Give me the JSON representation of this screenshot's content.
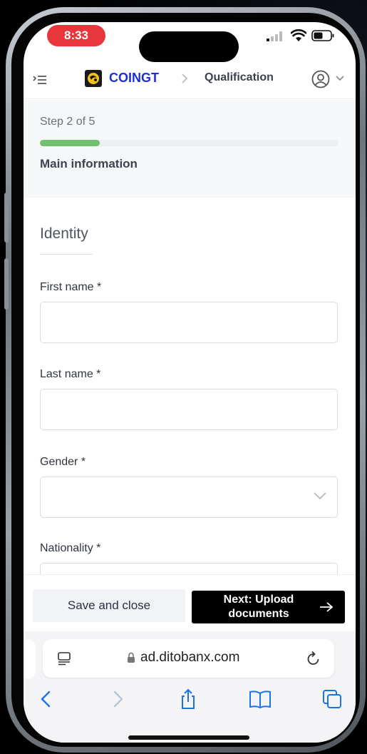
{
  "status_bar": {
    "time": "8:33"
  },
  "header": {
    "brand": "COINGT",
    "breadcrumb": "Qualification"
  },
  "step": {
    "label": "Step 2 of 5",
    "current": 2,
    "total": 5,
    "section_title": "Main information"
  },
  "form": {
    "section": "Identity",
    "fields": [
      {
        "label": "First name *",
        "value": ""
      },
      {
        "label": "Last name *",
        "value": ""
      },
      {
        "label": "Gender *",
        "value": ""
      },
      {
        "label": "Nationality *",
        "value": ""
      }
    ]
  },
  "actions": {
    "save_label": "Save and close",
    "next_label_line1": "Next: Upload",
    "next_label_line2": "documents"
  },
  "browser": {
    "url": "ad.ditobanx.com"
  },
  "colors": {
    "brand": "#1f2fd6",
    "progress": "#72c06f",
    "status_pill": "#e9363d",
    "primary_button": "#000000"
  }
}
